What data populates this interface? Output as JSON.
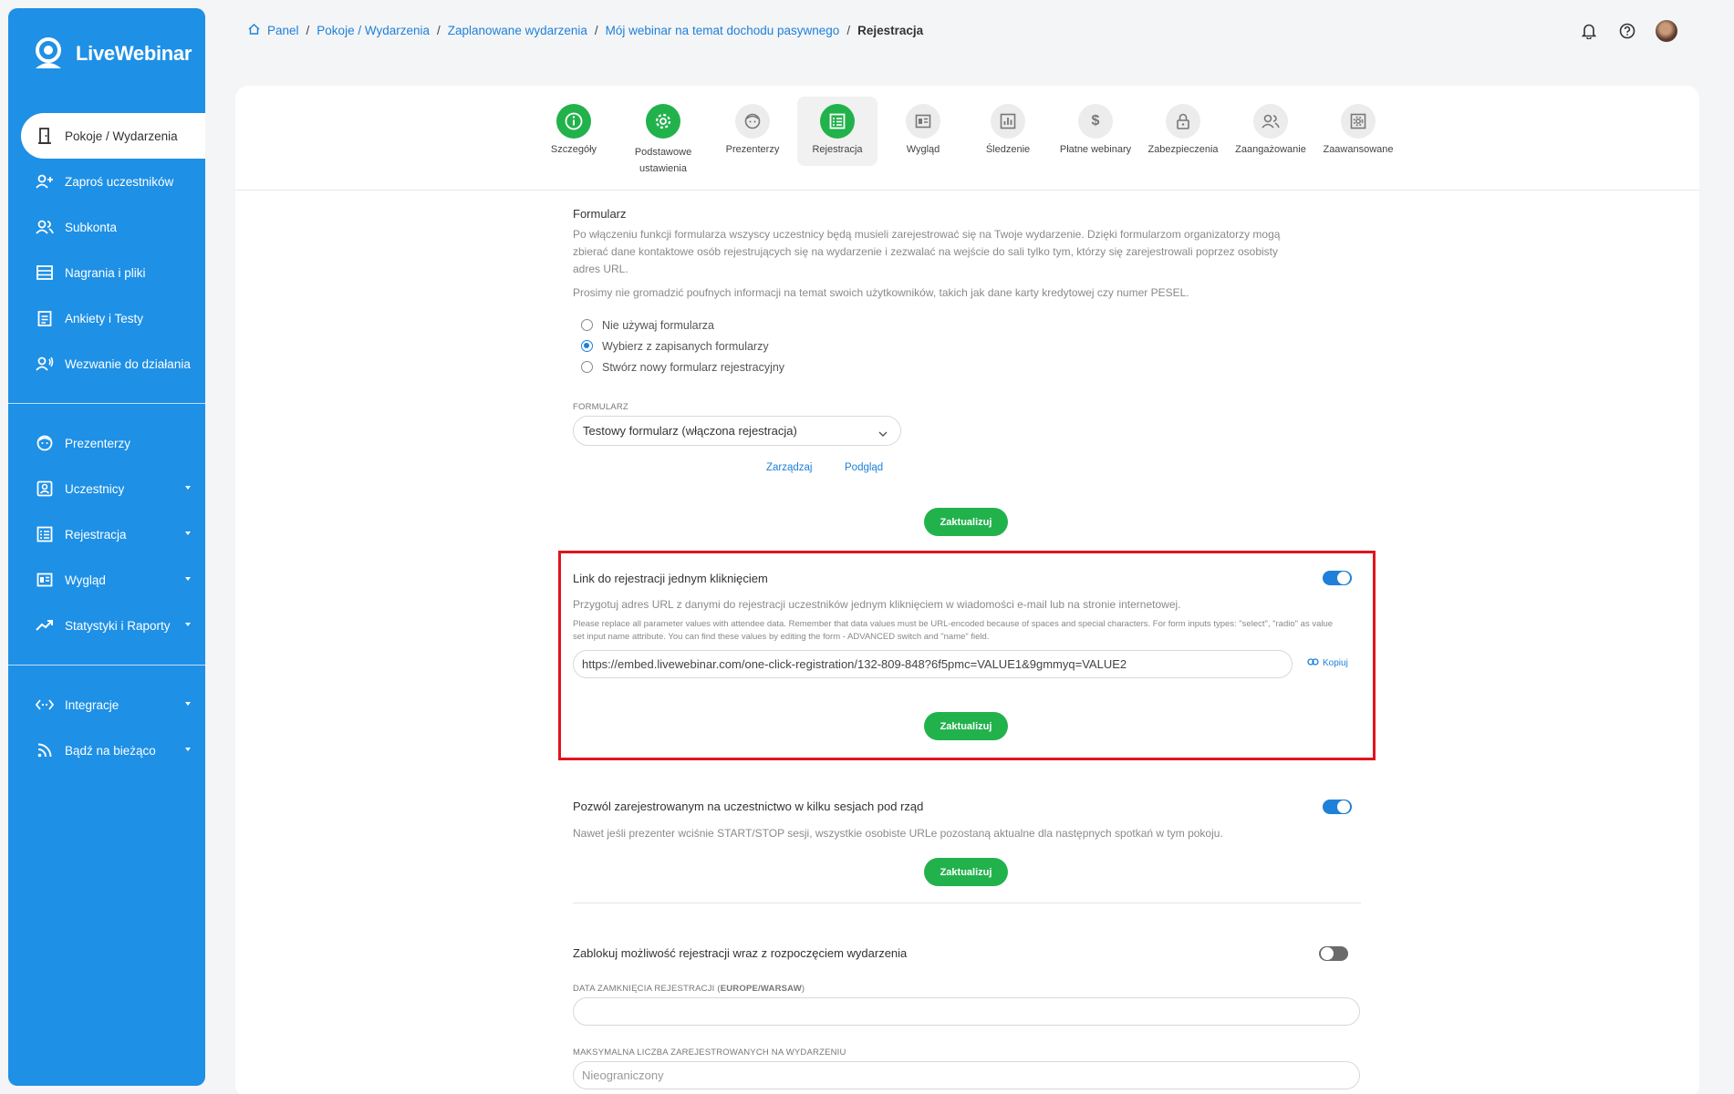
{
  "brand": {
    "logo_text": "LiveWebinar",
    "accent": "#1e90e6",
    "green": "#22b24c",
    "highlight": "#e0141e"
  },
  "sidebar": {
    "items": [
      {
        "label": "Pokoje / Wydarzenia",
        "icon": "door-icon"
      },
      {
        "label": "Zaproś uczestników",
        "icon": "user-plus-icon"
      },
      {
        "label": "Subkonta",
        "icon": "users-icon"
      },
      {
        "label": "Nagrania i pliki",
        "icon": "recordings-icon"
      },
      {
        "label": "Ankiety i Testy",
        "icon": "survey-icon"
      },
      {
        "label": "Wezwanie do działania",
        "icon": "call-to-action-icon"
      },
      {
        "label": "Prezenterzy",
        "icon": "presenter-icon"
      },
      {
        "label": "Uczestnicy",
        "icon": "attendees-icon"
      },
      {
        "label": "Rejestracja",
        "icon": "registration-icon"
      },
      {
        "label": "Wygląd",
        "icon": "layout-icon"
      },
      {
        "label": "Statystyki i Raporty",
        "icon": "chart-line-icon"
      },
      {
        "label": "Integracje",
        "icon": "integration-icon"
      },
      {
        "label": "Bądź na bieżąco",
        "icon": "rss-icon"
      }
    ]
  },
  "breadcrumb": {
    "items": [
      "Panel",
      "Pokoje / Wydarzenia",
      "Zaplanowane wydarzenia",
      "Mój webinar na temat dochodu pasywnego"
    ],
    "current": "Rejestracja",
    "separator": "/"
  },
  "tabs": [
    {
      "label": "Szczegóły"
    },
    {
      "label": "Podstawowe ustawienia"
    },
    {
      "label": "Prezenterzy"
    },
    {
      "label": "Rejestracja"
    },
    {
      "label": "Wygląd"
    },
    {
      "label": "Śledzenie"
    },
    {
      "label": "Płatne webinary"
    },
    {
      "label": "Zabezpieczenia"
    },
    {
      "label": "Zaangażowanie"
    },
    {
      "label": "Zaawansowane"
    }
  ],
  "form_section": {
    "title": "Formularz",
    "desc1": "Po włączeniu funkcji formularza wszyscy uczestnicy będą musieli zarejestrować się na Twoje wydarzenie. Dzięki formularzom organizatorzy mogą zbierać dane kontaktowe osób rejestrujących się na wydarzenie i zezwalać na wejście do sali tylko tym, którzy się zarejestrowali poprzez osobisty adres URL.",
    "desc2": "Prosimy nie gromadzić poufnych informacji na temat swoich użytkowników, takich jak dane karty kredytowej czy numer PESEL.",
    "radios": [
      "Nie używaj formularza",
      "Wybierz z zapisanych formularzy",
      "Stwórz nowy formularz rejestracyjny"
    ],
    "selected_radio": 1,
    "select_label": "FORMULARZ",
    "select_value": "Testowy formularz (włączona rejestracja)",
    "manage_link": "Zarządzaj",
    "preview_link": "Podgląd",
    "update": "Zaktualizuj"
  },
  "oneclick_section": {
    "title": "Link do rejestracji jednym kliknięciem",
    "enabled": true,
    "desc": "Przygotuj adres URL z danymi do rejestracji uczestników jednym kliknięciem w wiadomości e-mail lub na stronie internetowej.",
    "note": "Please replace all parameter values with attendee data. Remember that data values must be URL-encoded because of spaces and special characters. For form inputs types: \"select\", \"radio\" as value set input name attribute. You can find these values by editing the form - ADVANCED switch and \"name\" field.",
    "url": "https://embed.livewebinar.com/one-click-registration/132-809-848?6f5pmc=VALUE1&9gmmyq=VALUE2",
    "copy": "Kopiuj",
    "update": "Zaktualizuj"
  },
  "sessions_section": {
    "title": "Pozwól zarejestrowanym na uczestnictwo w kilku sesjach pod rząd",
    "enabled": true,
    "desc": "Nawet jeśli prezenter wciśnie START/STOP sesji, wszystkie osobiste URLe pozostaną aktualne dla następnych spotkań w tym pokoju.",
    "update": "Zaktualizuj"
  },
  "block_section": {
    "title": "Zablokuj możliwość rejestracji wraz z rozpoczęciem wydarzenia",
    "enabled": false,
    "date_label_prefix": "DATA ZAMKNIĘCIA REJESTRACJI (",
    "date_label_tz": "EUROPE/WARSAW",
    "date_label_suffix": ")",
    "date_value": "",
    "max_label": "MAKSYMALNA LICZBA ZAREJESTROWANYCH NA WYDARZENIU",
    "max_placeholder": "Nieograniczony"
  }
}
